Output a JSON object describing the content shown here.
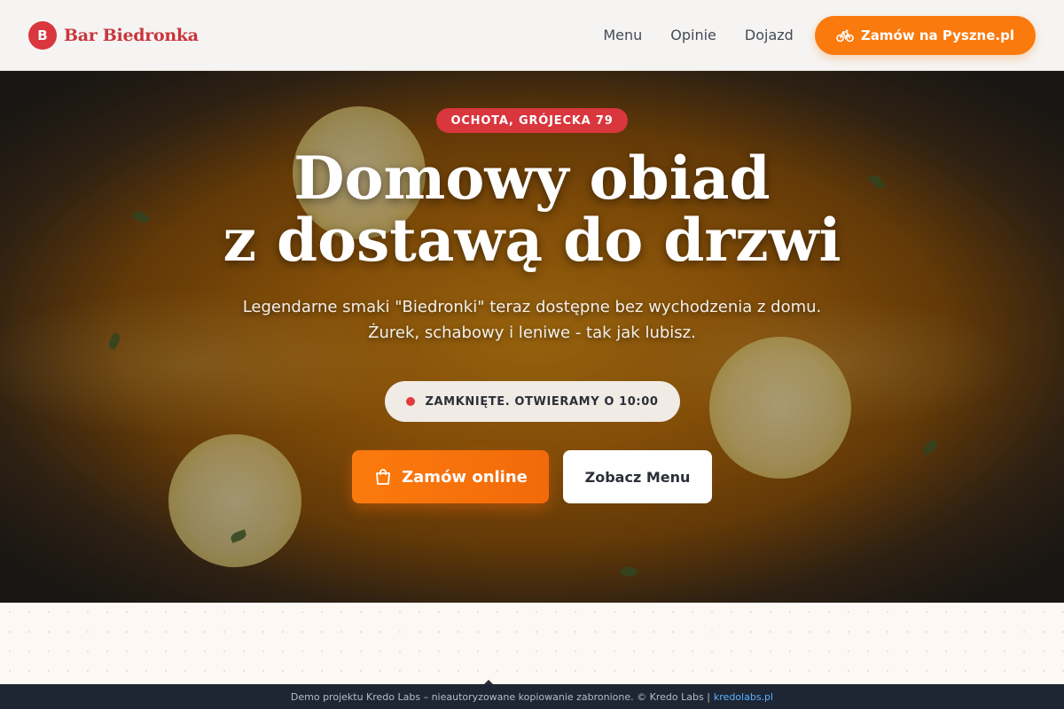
{
  "header": {
    "brand_initial": "B",
    "brand_name": "Bar Biedronka",
    "nav": [
      {
        "label": "Menu"
      },
      {
        "label": "Opinie"
      },
      {
        "label": "Dojazd"
      }
    ],
    "order_button": {
      "label": "Zamów na Pyszne.pl",
      "icon": "bicycle-icon"
    }
  },
  "hero": {
    "location": "OCHOTA, GRÓJECKA 79",
    "headline_line1": "Domowy obiad",
    "headline_line2": "z dostawą do drzwi",
    "subline_line1": "Legendarne smaki \"Biedronki\" teraz dostępne bez wychodzenia z domu.",
    "subline_line2": "Żurek, schabowy i leniwe - tak jak lubisz.",
    "status": "ZAMKNIĘTE. OTWIERAMY O 10:00",
    "primary_cta": {
      "label": "Zamów online",
      "icon": "shopping-bag-icon"
    },
    "secondary_cta": {
      "label": "Zobacz Menu"
    }
  },
  "footer": {
    "text": "Demo projektu Kredo Labs – nieautoryzowane kopiowanie zabronione. © Kredo Labs |",
    "link": "kredolabs.pl"
  },
  "colors": {
    "brand_red": "#d9363e",
    "accent_orange": "#fb7a0d",
    "status_closed": "#e03b3b",
    "footer_bg": "#1e2533"
  }
}
